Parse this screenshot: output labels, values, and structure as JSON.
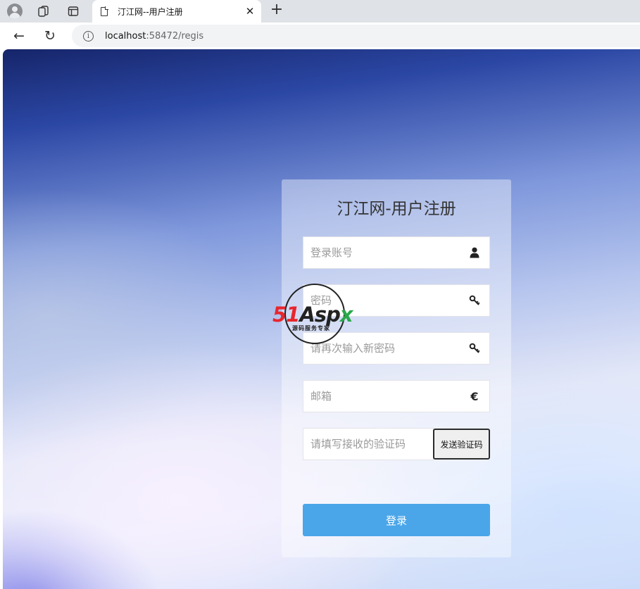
{
  "browser": {
    "tab_title": "汀江网--用户注册",
    "tab_close": "✕",
    "new_tab": "+",
    "url_host": "localhost",
    "url_path": ":58472/regis",
    "back": "←",
    "reload": "↻",
    "info": "i"
  },
  "form": {
    "title": "汀江网-用户注册",
    "fields": [
      {
        "placeholder": "登录账号",
        "icon": "user-icon"
      },
      {
        "placeholder": "密码",
        "icon": "key-icon"
      },
      {
        "placeholder": "请再次输入新密码",
        "icon": "key-icon"
      },
      {
        "placeholder": "邮箱",
        "icon": "euro-icon",
        "icon_text": "€"
      },
      {
        "placeholder": "请填写接收的验证码"
      }
    ],
    "send_code_label": "发送验证码",
    "submit_label": "登录"
  },
  "watermark": {
    "brand_red": "51",
    "brand_dark": "Asp",
    "brand_green": "x",
    "subtitle": "源码服务专家"
  },
  "colors": {
    "submit": "#4aa6e9",
    "watermark_red": "#e8262d",
    "watermark_green": "#29a84a"
  }
}
